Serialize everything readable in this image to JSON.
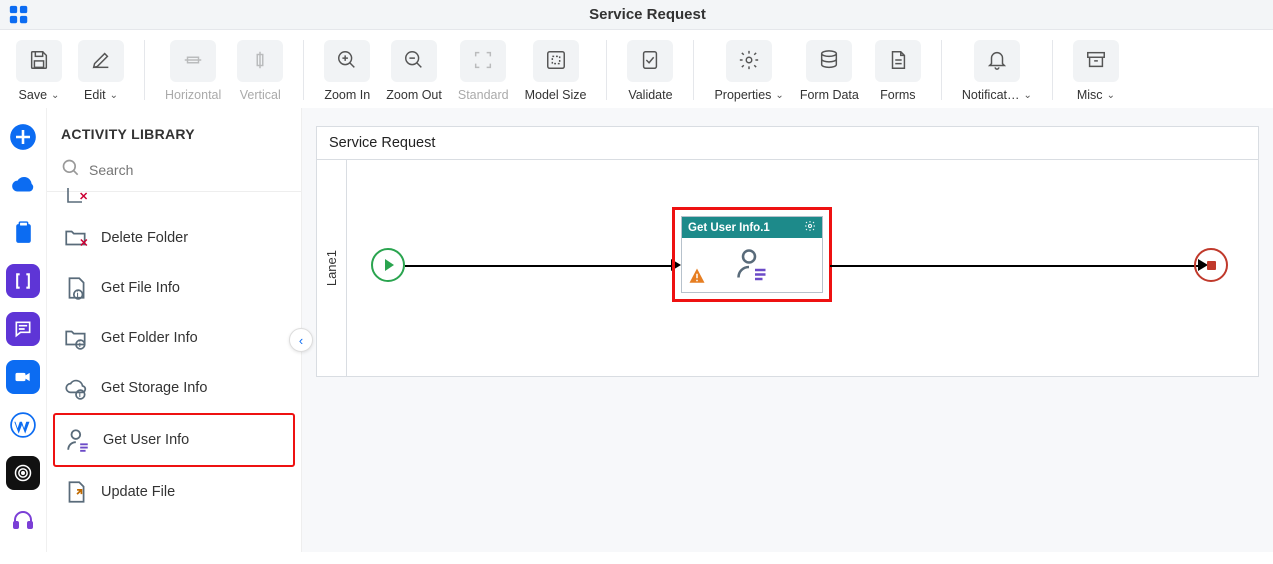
{
  "header": {
    "title": "Service Request"
  },
  "toolbar": {
    "save": "Save",
    "edit": "Edit",
    "horizontal": "Horizontal",
    "vertical": "Vertical",
    "zoom_in": "Zoom In",
    "zoom_out": "Zoom Out",
    "standard": "Standard",
    "model_size": "Model Size",
    "validate": "Validate",
    "properties": "Properties",
    "form_data": "Form Data",
    "forms": "Forms",
    "notifications": "Notificat…",
    "misc": "Misc"
  },
  "sidebar": {
    "title": "ACTIVITY LIBRARY",
    "search_placeholder": "Search",
    "items": [
      {
        "label": "Delete Folder"
      },
      {
        "label": "Get File Info"
      },
      {
        "label": "Get Folder Info"
      },
      {
        "label": "Get Storage Info"
      },
      {
        "label": "Get User Info"
      },
      {
        "label": "Update File"
      }
    ]
  },
  "canvas": {
    "pool_title": "Service Request",
    "lane_label": "Lane1",
    "task_title": "Get User Info.1"
  }
}
